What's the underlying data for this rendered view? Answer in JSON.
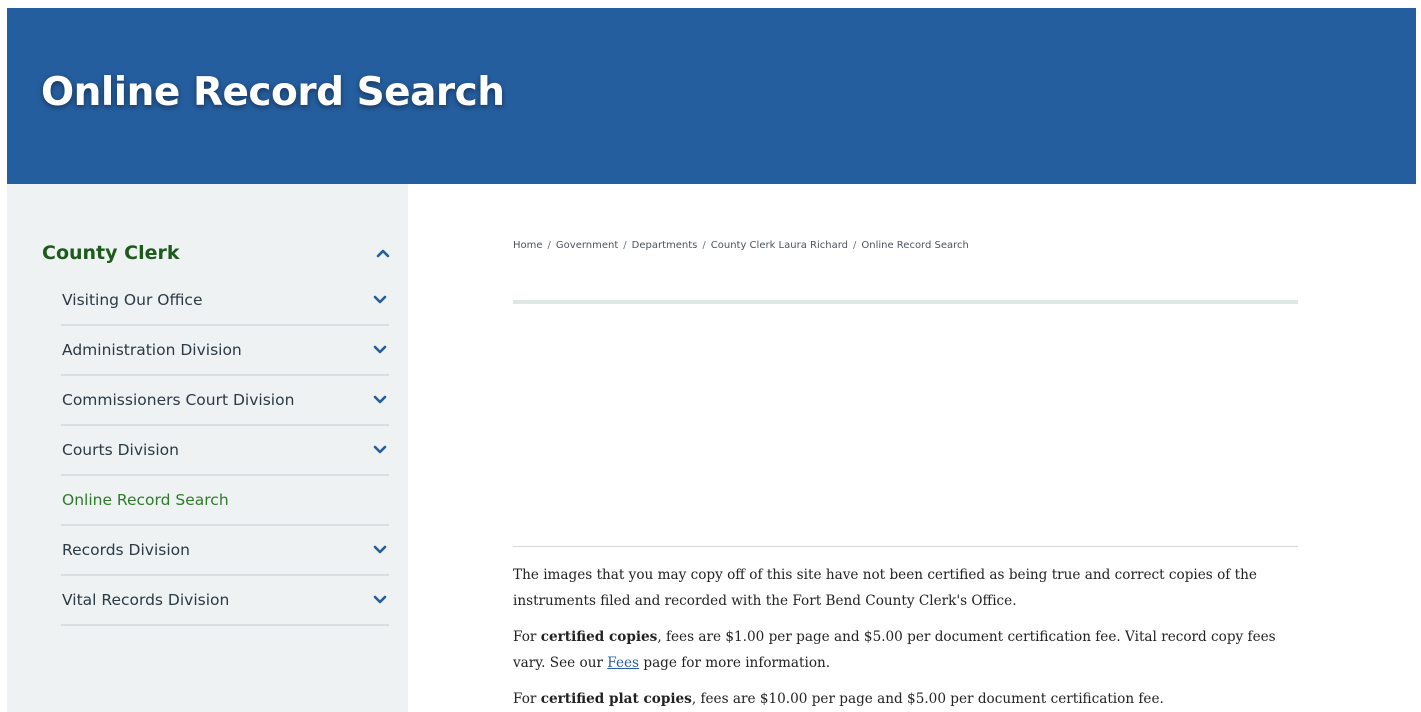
{
  "page_title": "Online Record Search",
  "sidebar": {
    "heading": "County Clerk",
    "items": [
      {
        "label": "Visiting Our Office",
        "has_children": true
      },
      {
        "label": "Administration Division",
        "has_children": true
      },
      {
        "label": "Commissioners Court Division",
        "has_children": true
      },
      {
        "label": "Courts Division",
        "has_children": true
      },
      {
        "label": "Online Record Search",
        "has_children": false,
        "active": true
      },
      {
        "label": "Records Division",
        "has_children": true
      },
      {
        "label": "Vital Records Division",
        "has_children": true
      }
    ]
  },
  "breadcrumb": [
    "Home",
    "Government",
    "Departments",
    "County Clerk Laura Richard",
    "Online Record Search"
  ],
  "breadcrumb_separator": "/",
  "content": {
    "p1": "The images that you may copy off of this site have not been certified as being true and correct copies of the instruments filed and recorded with the Fort Bend County Clerk's Office.",
    "p2_prefix": "For ",
    "p2_bold": "certified copies",
    "p2_rest": ", fees are $1.00 per page and $5.00 per document certification fee. Vital record copy fees vary. See our ",
    "p2_link": "Fees",
    "p2_suffix": " page for more information.",
    "p3_prefix": "For ",
    "p3_bold": "certified plat copies",
    "p3_rest": ", fees are $10.00 per page and $5.00 per document certification fee."
  },
  "colors": {
    "banner": "#255e9f",
    "sidebar_bg": "#eef2f3",
    "sidebar_heading": "#1f5a1d",
    "active_item": "#2f7a2b",
    "chevron": "#255e9f",
    "link": "#2a5fa8"
  },
  "icons": {
    "expand": "chevron-down-icon",
    "collapse": "chevron-up-icon"
  }
}
